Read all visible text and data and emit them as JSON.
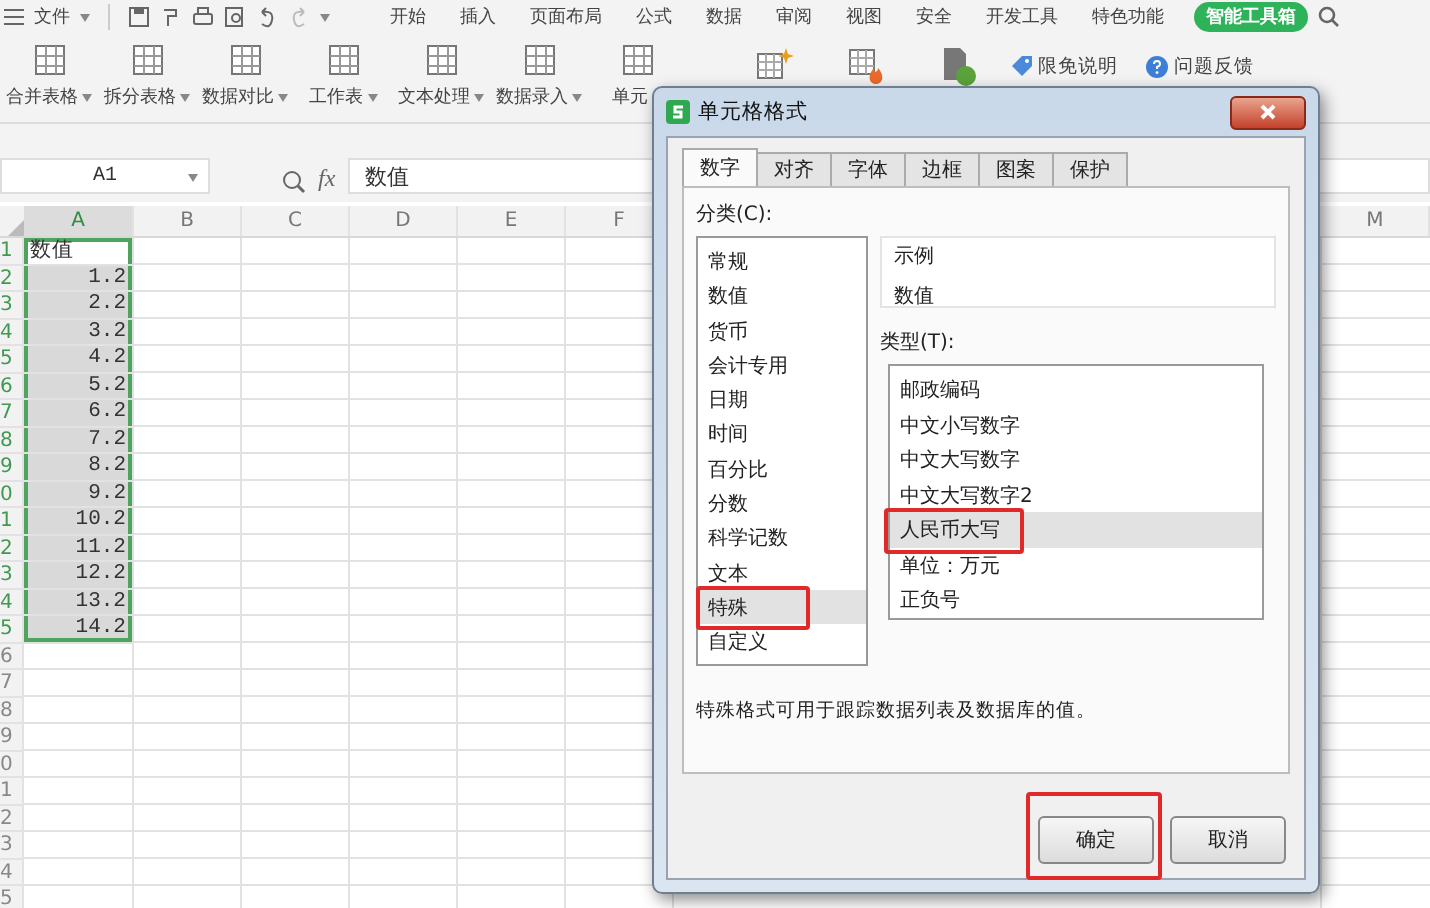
{
  "menu": {
    "file": "文件",
    "tabs": [
      "开始",
      "插入",
      "页面布局",
      "公式",
      "数据",
      "审阅",
      "视图",
      "安全",
      "开发工具",
      "特色功能"
    ],
    "smart_tools": "智能工具箱"
  },
  "ribbon": {
    "tools": [
      "合并表格",
      "拆分表格",
      "数据对比",
      "工作表",
      "文本处理",
      "数据录入",
      "单元"
    ],
    "links": [
      "限免说明",
      "问题反馈"
    ]
  },
  "formula_bar": {
    "cell_ref": "A1",
    "function_label": "fx",
    "value": "数值"
  },
  "sheet": {
    "columns": [
      {
        "label": "A",
        "selected": true
      },
      {
        "label": "B",
        "selected": false
      },
      {
        "label": "C",
        "selected": false
      },
      {
        "label": "D",
        "selected": false
      },
      {
        "label": "E",
        "selected": false
      },
      {
        "label": "F",
        "selected": false
      }
    ],
    "columns_right": [
      {
        "label": "M",
        "selected": false
      }
    ],
    "rows": [
      {
        "label": "1",
        "selected": true,
        "cells": [
          {
            "text": "数值",
            "kind": "text",
            "active": true
          }
        ]
      },
      {
        "label": "2",
        "selected": true,
        "cells": [
          {
            "text": "1.2",
            "kind": "number",
            "active": false
          }
        ]
      },
      {
        "label": "3",
        "selected": true,
        "cells": [
          {
            "text": "2.2",
            "kind": "number",
            "active": false
          }
        ]
      },
      {
        "label": "4",
        "selected": true,
        "cells": [
          {
            "text": "3.2",
            "kind": "number",
            "active": false
          }
        ]
      },
      {
        "label": "5",
        "selected": true,
        "cells": [
          {
            "text": "4.2",
            "kind": "number",
            "active": false
          }
        ]
      },
      {
        "label": "6",
        "selected": true,
        "cells": [
          {
            "text": "5.2",
            "kind": "number",
            "active": false
          }
        ]
      },
      {
        "label": "7",
        "selected": true,
        "cells": [
          {
            "text": "6.2",
            "kind": "number",
            "active": false
          }
        ]
      },
      {
        "label": "8",
        "selected": true,
        "cells": [
          {
            "text": "7.2",
            "kind": "number",
            "active": false
          }
        ]
      },
      {
        "label": "9",
        "selected": true,
        "cells": [
          {
            "text": "8.2",
            "kind": "number",
            "active": false
          }
        ]
      },
      {
        "label": "0",
        "selected": true,
        "cells": [
          {
            "text": "9.2",
            "kind": "number",
            "active": false
          }
        ]
      },
      {
        "label": "1",
        "selected": true,
        "cells": [
          {
            "text": "10.2",
            "kind": "number",
            "active": false
          }
        ]
      },
      {
        "label": "2",
        "selected": true,
        "cells": [
          {
            "text": "11.2",
            "kind": "number",
            "active": false
          }
        ]
      },
      {
        "label": "3",
        "selected": true,
        "cells": [
          {
            "text": "12.2",
            "kind": "number",
            "active": false
          }
        ]
      },
      {
        "label": "4",
        "selected": true,
        "cells": [
          {
            "text": "13.2",
            "kind": "number",
            "active": false
          }
        ]
      },
      {
        "label": "5",
        "selected": true,
        "cells": [
          {
            "text": "14.2",
            "kind": "number",
            "active": false
          }
        ]
      },
      {
        "label": "6",
        "selected": false,
        "cells": []
      },
      {
        "label": "7",
        "selected": false,
        "cells": []
      },
      {
        "label": "8",
        "selected": false,
        "cells": []
      },
      {
        "label": "9",
        "selected": false,
        "cells": []
      },
      {
        "label": "0",
        "selected": false,
        "cells": []
      },
      {
        "label": "1",
        "selected": false,
        "cells": []
      },
      {
        "label": "2",
        "selected": false,
        "cells": []
      },
      {
        "label": "3",
        "selected": false,
        "cells": []
      },
      {
        "label": "4",
        "selected": false,
        "cells": []
      },
      {
        "label": "5",
        "selected": false,
        "cells": []
      }
    ]
  },
  "dialog": {
    "title": "单元格格式",
    "tabs": [
      {
        "label": "数字",
        "selected": true
      },
      {
        "label": "对齐",
        "selected": false
      },
      {
        "label": "字体",
        "selected": false
      },
      {
        "label": "边框",
        "selected": false
      },
      {
        "label": "图案",
        "selected": false
      },
      {
        "label": "保护",
        "selected": false
      }
    ],
    "category_label": "分类(C):",
    "categories": [
      {
        "label": "常规",
        "selected": false,
        "marked": false
      },
      {
        "label": "数值",
        "selected": false,
        "marked": false
      },
      {
        "label": "货币",
        "selected": false,
        "marked": false
      },
      {
        "label": "会计专用",
        "selected": false,
        "marked": false
      },
      {
        "label": "日期",
        "selected": false,
        "marked": false
      },
      {
        "label": "时间",
        "selected": false,
        "marked": false
      },
      {
        "label": "百分比",
        "selected": false,
        "marked": false
      },
      {
        "label": "分数",
        "selected": false,
        "marked": false
      },
      {
        "label": "科学记数",
        "selected": false,
        "marked": false
      },
      {
        "label": "文本",
        "selected": false,
        "marked": false
      },
      {
        "label": "特殊",
        "selected": true,
        "marked": true
      },
      {
        "label": "自定义",
        "selected": false,
        "marked": false
      }
    ],
    "sample_label": "示例",
    "sample": "数值",
    "type_label": "类型(T):",
    "types": [
      {
        "label": "邮政编码",
        "selected": false,
        "marked": false
      },
      {
        "label": "中文小写数字",
        "selected": false,
        "marked": false
      },
      {
        "label": "中文大写数字",
        "selected": false,
        "marked": false
      },
      {
        "label": "中文大写数字2",
        "selected": false,
        "marked": false
      },
      {
        "label": "人民币大写",
        "selected": true,
        "marked": true
      },
      {
        "label": "单位：万元",
        "selected": false,
        "marked": false
      },
      {
        "label": "正负号",
        "selected": false,
        "marked": false
      }
    ],
    "description": "特殊格式可用于跟踪数据列表及数据库的值。",
    "buttons": [
      {
        "label": "确定",
        "marked": true
      },
      {
        "label": "取消",
        "marked": false
      }
    ]
  }
}
